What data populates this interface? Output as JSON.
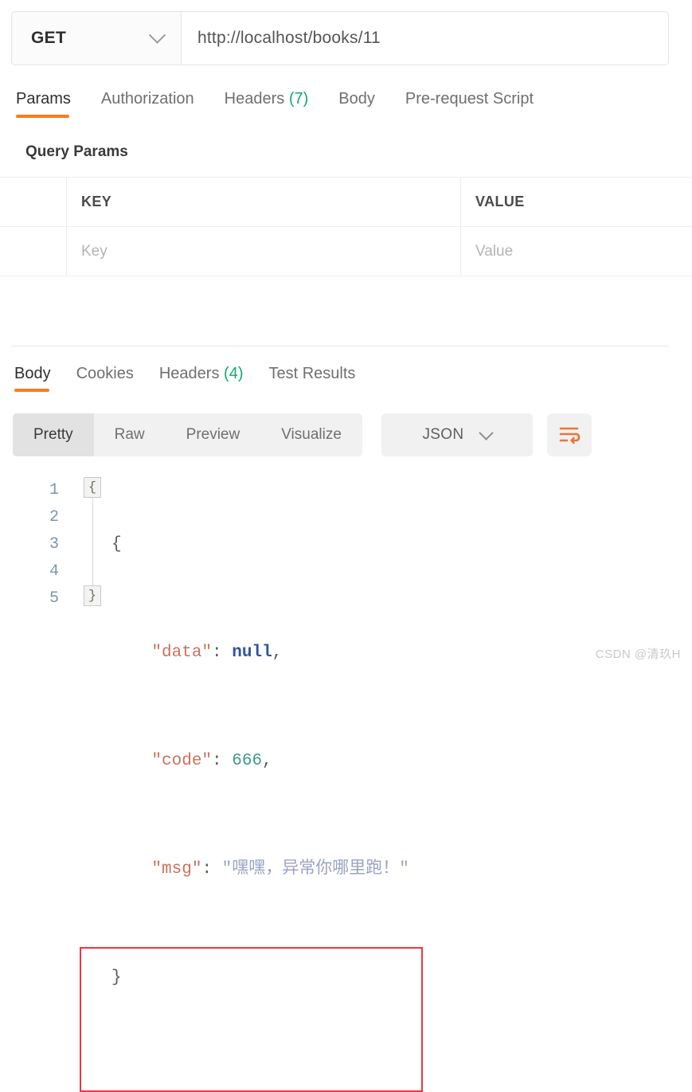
{
  "request": {
    "method": "GET",
    "method_icon": "chevron-down-icon",
    "url": "http://localhost/books/11",
    "tabs": [
      {
        "label": "Params",
        "active": true
      },
      {
        "label": "Authorization",
        "active": false
      },
      {
        "label": "Headers",
        "count": "(7)",
        "active": false
      },
      {
        "label": "Body",
        "active": false
      },
      {
        "label": "Pre-request Script",
        "active": false
      }
    ],
    "query_params": {
      "title": "Query Params",
      "columns": [
        "KEY",
        "VALUE"
      ],
      "rows": [
        {
          "key_placeholder": "Key",
          "value_placeholder": "Value"
        }
      ]
    }
  },
  "response": {
    "tabs": [
      {
        "label": "Body",
        "active": true
      },
      {
        "label": "Cookies",
        "active": false
      },
      {
        "label": "Headers",
        "count": "(4)",
        "active": false
      },
      {
        "label": "Test Results",
        "active": false
      }
    ],
    "format_modes": [
      {
        "label": "Pretty",
        "active": true
      },
      {
        "label": "Raw",
        "active": false
      },
      {
        "label": "Preview",
        "active": false
      },
      {
        "label": "Visualize",
        "active": false
      }
    ],
    "language": "JSON",
    "language_icon": "chevron-down-icon",
    "wrap_icon": "wrap-lines-icon",
    "body": {
      "line_numbers": [
        "1",
        "2",
        "3",
        "4",
        "5"
      ],
      "fold_open": "{",
      "fold_close": "}",
      "lines": [
        {
          "indent": "",
          "text": "{",
          "kind": "brace"
        },
        {
          "indent": "    ",
          "key": "\"data\"",
          "sep": ": ",
          "value": "null",
          "kind": "null",
          "trail": ","
        },
        {
          "indent": "    ",
          "key": "\"code\"",
          "sep": ": ",
          "value": "666",
          "kind": "number",
          "trail": ","
        },
        {
          "indent": "    ",
          "key": "\"msg\"",
          "sep": ": ",
          "value": "\"嘿嘿，异常你哪里跑！\"",
          "kind": "string",
          "trail": ""
        },
        {
          "indent": "",
          "text": "}",
          "kind": "brace"
        }
      ]
    }
  },
  "annotation": {
    "highlight_color": "#f5333f"
  },
  "watermark": "CSDN @清玖H",
  "colors": {
    "accent": "#ff7a1a",
    "badge_green": "#12a870",
    "json_key": "#c8725f",
    "json_null": "#2f54a0",
    "json_number": "#3e9a8c",
    "json_string": "#9aa3c4"
  }
}
